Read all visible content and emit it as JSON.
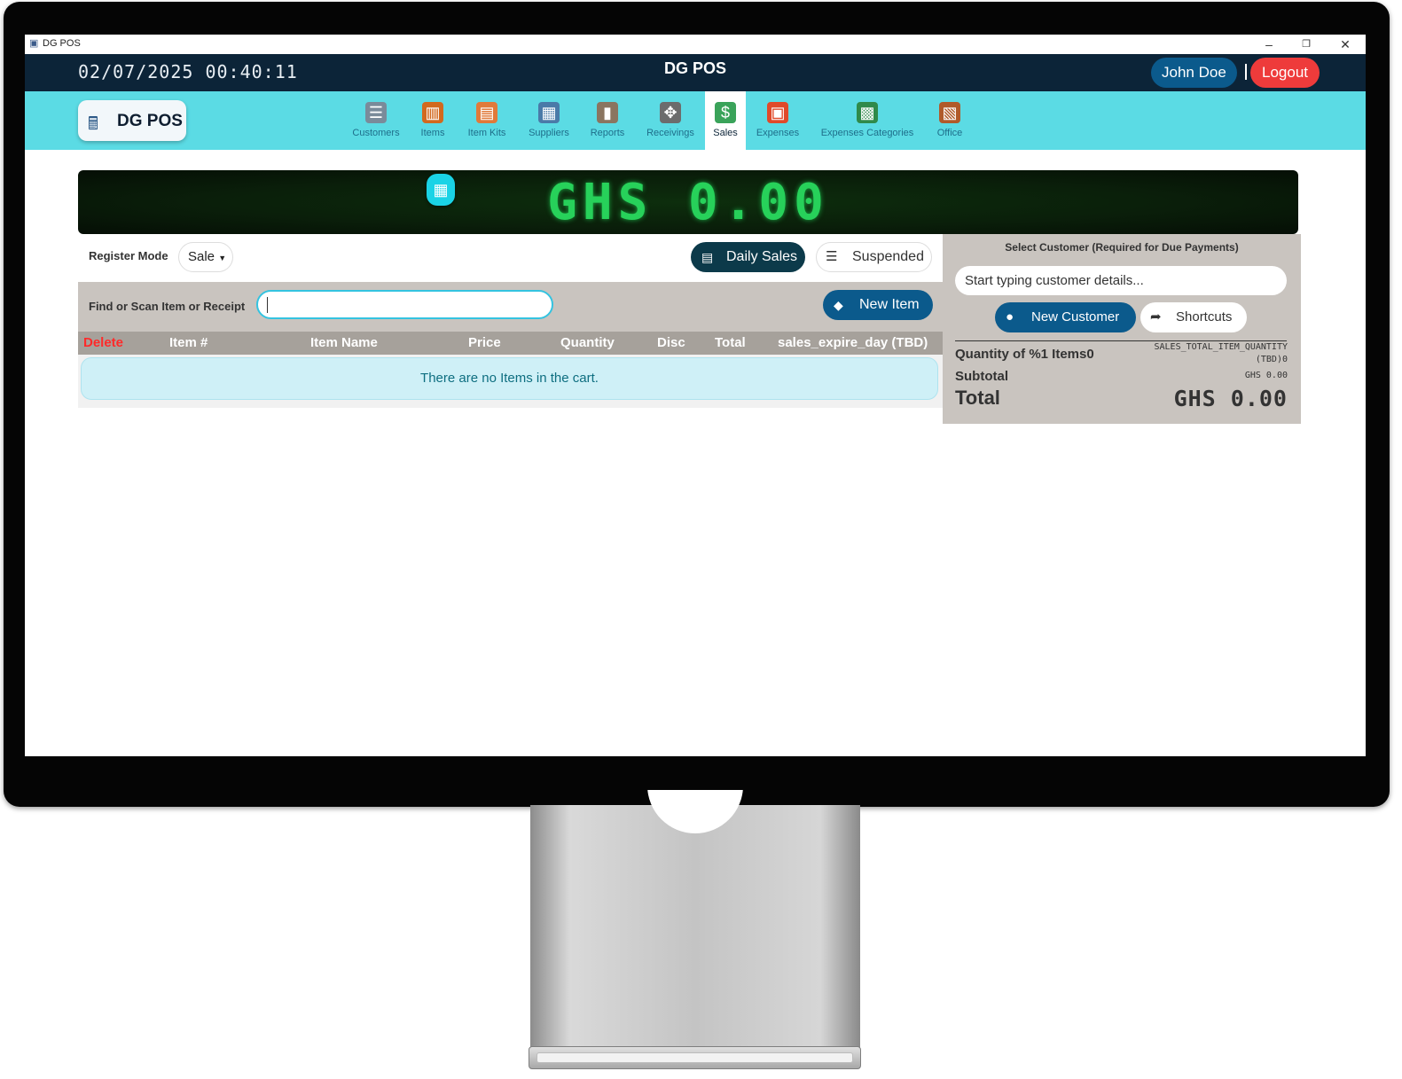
{
  "window": {
    "title": "DG POS",
    "app_icon": "cash-register-icon",
    "controls": {
      "minimize": "–",
      "restore": "❐",
      "close": "✕"
    }
  },
  "header": {
    "clock": "02/07/2025 00:40:11",
    "app_title": "DG POS",
    "user_name": "John Doe",
    "separator": "|",
    "logout_label": "Logout",
    "colors": {
      "bar": "#0c2438",
      "user": "#0b5a8c",
      "logout": "#ee3b3b"
    }
  },
  "navbar": {
    "logo_text": "DG POS",
    "logo_icon": "cash-register-icon",
    "background": "#5bdbe4",
    "items": [
      {
        "label": "Customers",
        "icon": "customers-icon",
        "active": false
      },
      {
        "label": "Items",
        "icon": "items-icon",
        "active": false
      },
      {
        "label": "Item Kits",
        "icon": "item-kits-icon",
        "active": false
      },
      {
        "label": "Suppliers",
        "icon": "suppliers-icon",
        "active": false
      },
      {
        "label": "Reports",
        "icon": "reports-icon",
        "active": false
      },
      {
        "label": "Receivings",
        "icon": "receivings-icon",
        "active": false
      },
      {
        "label": "Sales",
        "icon": "sales-icon",
        "active": true
      },
      {
        "label": "Expenses",
        "icon": "expenses-icon",
        "active": false
      },
      {
        "label": "Expenses Categories",
        "icon": "expenses-categories-icon",
        "active": false
      },
      {
        "label": "Office",
        "icon": "office-icon",
        "active": false
      }
    ]
  },
  "display": {
    "amount": "GHS 0.00",
    "calculator_icon": "calculator-icon",
    "color": "#27d15a"
  },
  "register": {
    "mode_label": "Register Mode",
    "mode_value": "Sale",
    "daily_sales_label": "Daily Sales",
    "suspended_label": "Suspended",
    "find_label": "Find or Scan Item or Receipt",
    "find_value": "",
    "new_item_label": "New Item"
  },
  "cart": {
    "columns": [
      "Delete",
      "Item #",
      "Item Name",
      "Price",
      "Quantity",
      "Disc",
      "Total",
      "sales_expire_day (TBD)"
    ],
    "empty_message": "There are no Items in the cart."
  },
  "customer": {
    "title": "Select Customer (Required for Due Payments)",
    "search_placeholder": "Start typing customer details...",
    "new_customer_label": "New Customer",
    "shortcuts_label": "Shortcuts"
  },
  "summary": {
    "quantity_label": "Quantity of %1 Items0",
    "quantity_value_line1": "SALES_TOTAL_ITEM_QUANTITY",
    "quantity_value_line2": "(TBD)0",
    "subtotal_label": "Subtotal",
    "subtotal_value": "GHS 0.00",
    "total_label": "Total",
    "total_value": "GHS 0.00"
  }
}
